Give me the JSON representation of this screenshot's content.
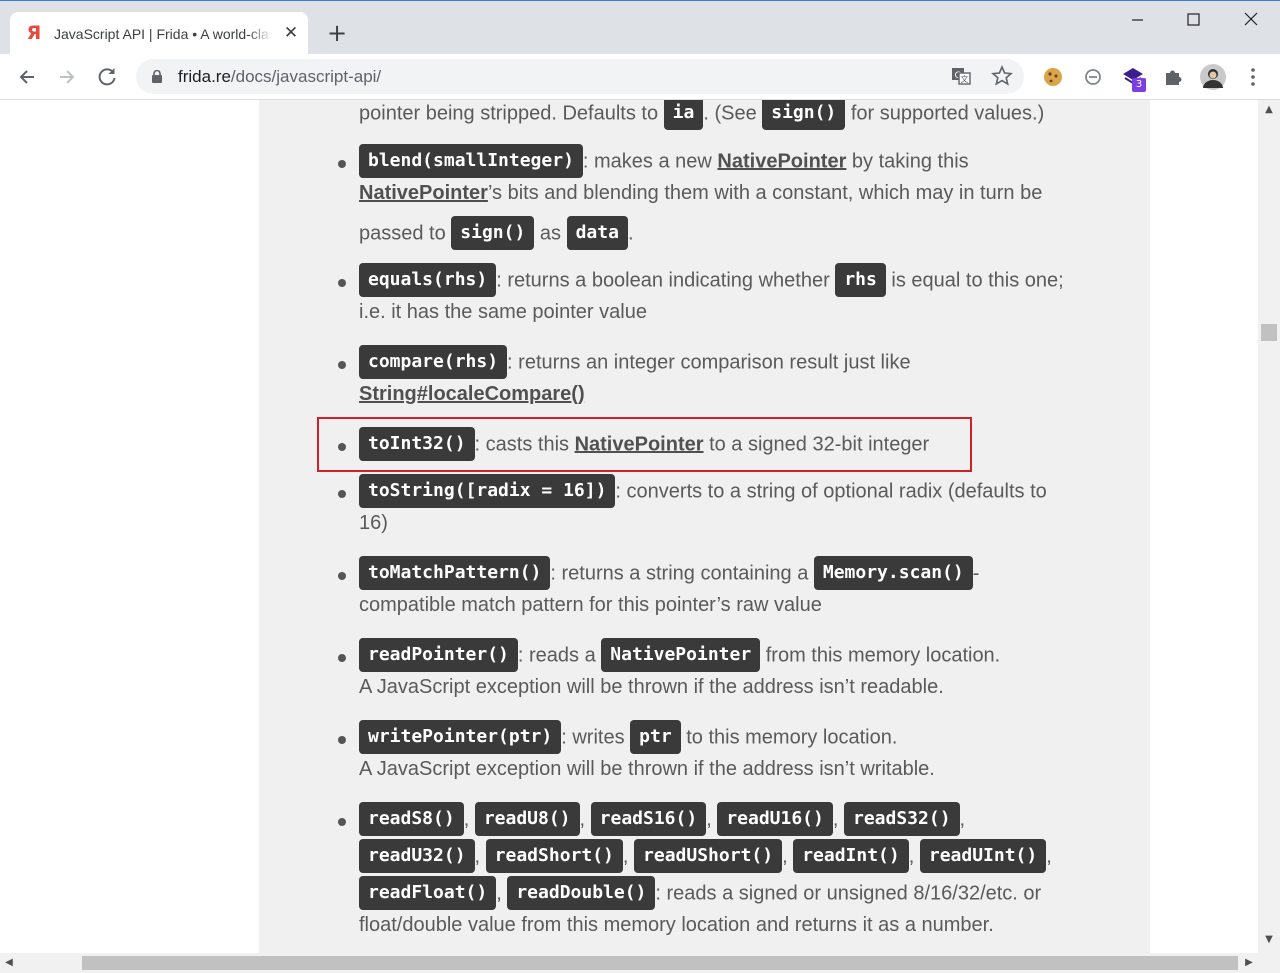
{
  "browser": {
    "tab_title": "JavaScript API | Frida • A world-class dynamic instrumentation toolkit",
    "tab_favicon_glyph": "Я",
    "tab_close": "✕",
    "new_tab": "+",
    "url_host": "frida.re",
    "url_path": "/docs/javascript-api/",
    "extension_badge": "3"
  },
  "colors": {
    "code_bg": "#3a3a3a",
    "highlight_border": "#d0212a",
    "content_bg": "#f0f0f0",
    "favicon": "#e54a3c"
  },
  "doc": {
    "item0": {
      "t1": "pointer being stripped. Defaults to ",
      "c1": "ia",
      "t2": ". (See ",
      "c2": "sign()",
      "t3": " for supported values.)"
    },
    "item1": {
      "c1": "blend(smallInteger)",
      "t1": ": makes a new ",
      "l1": "NativePointer",
      "t2": " by taking this",
      "l2": "NativePointer",
      "t3": "’s bits and blending them with a constant, which may in turn be",
      "t4": "passed to ",
      "c2": "sign()",
      "t5": " as ",
      "c3": "data",
      "t6": "."
    },
    "item2": {
      "c1": "equals(rhs)",
      "t1": ": returns a boolean indicating whether ",
      "c2": "rhs",
      "t2": " is equal to this one;",
      "t3": "i.e. it has the same pointer value"
    },
    "item3": {
      "c1": "compare(rhs)",
      "t1": ": returns an integer comparison result just like",
      "l1": "String#localeCompare()"
    },
    "item4": {
      "c1": "toInt32()",
      "t1": ": casts this ",
      "l1": "NativePointer",
      "t2": " to a signed 32-bit integer"
    },
    "item5": {
      "c1": "toString([radix = 16])",
      "t1": ": converts to a string of optional radix (defaults to",
      "t2": "16)"
    },
    "item6": {
      "c1": "toMatchPattern()",
      "t1": ": returns a string containing a ",
      "c2": "Memory.scan()",
      "t2": "-",
      "t3": "compatible match pattern for this pointer’s raw value"
    },
    "item7": {
      "c1": "readPointer()",
      "t1": ": reads a ",
      "c2": "NativePointer",
      "t2": " from this memory location.",
      "t3": "A JavaScript exception will be thrown if the address isn’t readable."
    },
    "item8": {
      "c1": "writePointer(ptr)",
      "t1": ": writes ",
      "c2": "ptr",
      "t2": " to this memory location.",
      "t3": "A JavaScript exception will be thrown if the address isn’t writable."
    },
    "item9": {
      "codes": [
        "readS8()",
        "readU8()",
        "readS16()",
        "readU16()",
        "readS32()",
        "readU32()",
        "readShort()",
        "readUShort()",
        "readInt()",
        "readUInt()",
        "readFloat()",
        "readDouble()"
      ],
      "sep": ",",
      "t1": ": reads a signed or unsigned 8/16/32/etc. or",
      "t2": "float/double value from this memory location and returns it as a number."
    }
  }
}
